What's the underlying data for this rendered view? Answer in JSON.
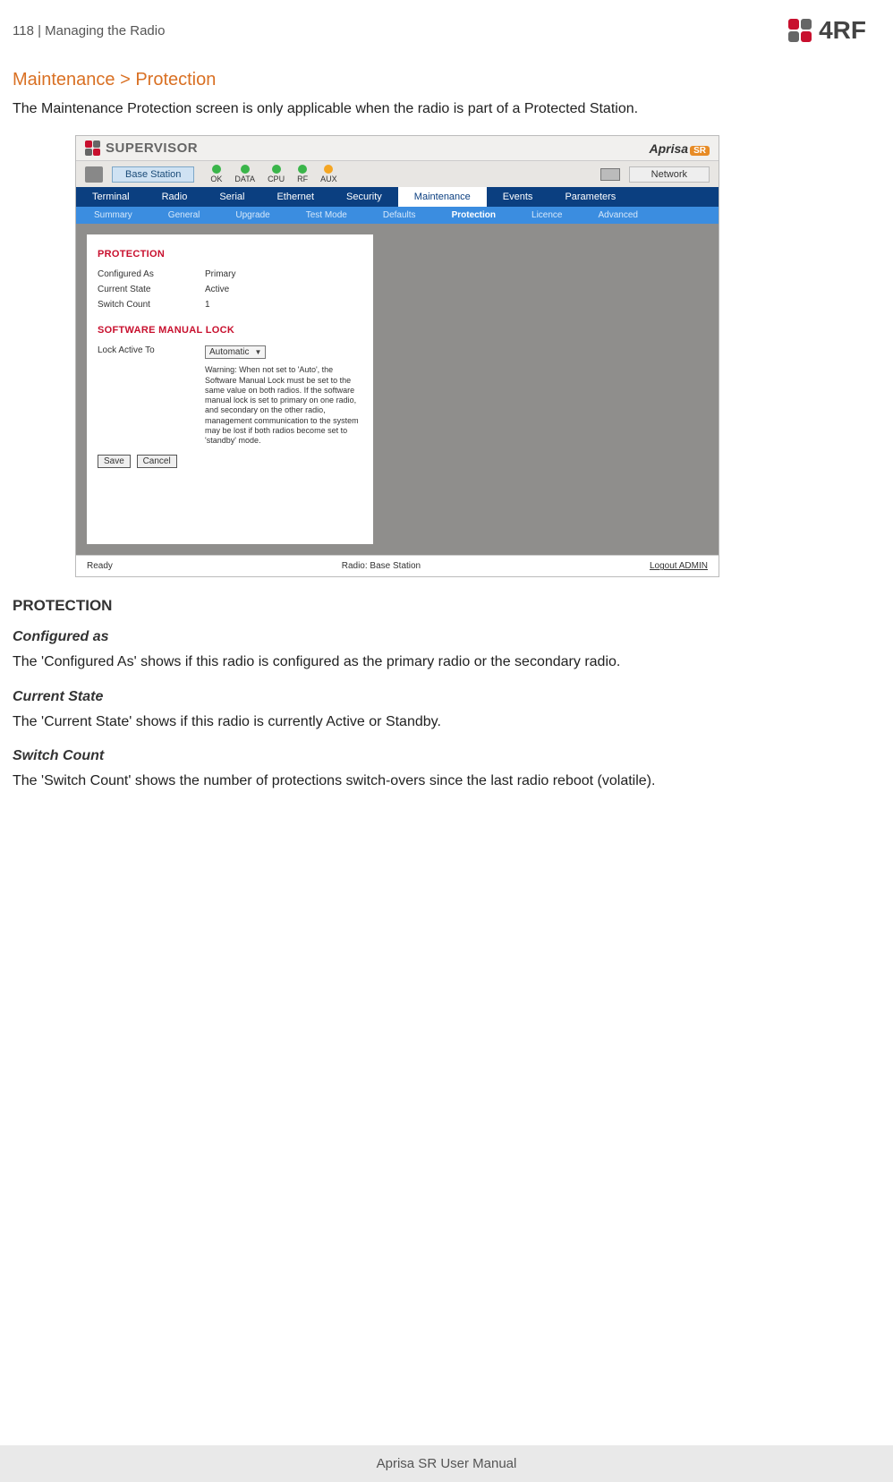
{
  "header": {
    "page_number": "118",
    "section": "Managing the Radio",
    "brand": "4RF"
  },
  "page": {
    "title": "Maintenance > Protection",
    "intro": "The Maintenance Protection screen is only applicable when the radio is part of a Protected Station.",
    "footer": "Aprisa SR User Manual"
  },
  "screenshot": {
    "supervisor_label": "SUPERVISOR",
    "product_logo": {
      "name": "Aprisa",
      "suffix": "SR"
    },
    "station_type": "Base Station",
    "leds": [
      "OK",
      "DATA",
      "CPU",
      "RF",
      "AUX"
    ],
    "network_label": "Network",
    "nav_main": [
      "Terminal",
      "Radio",
      "Serial",
      "Ethernet",
      "Security",
      "Maintenance",
      "Events",
      "Parameters"
    ],
    "nav_main_active": "Maintenance",
    "nav_sub": [
      "Summary",
      "General",
      "Upgrade",
      "Test Mode",
      "Defaults",
      "Protection",
      "Licence",
      "Advanced"
    ],
    "nav_sub_active": "Protection",
    "panel": {
      "protection_header": "PROTECTION",
      "configured_as_label": "Configured As",
      "configured_as_value": "Primary",
      "current_state_label": "Current State",
      "current_state_value": "Active",
      "switch_count_label": "Switch Count",
      "switch_count_value": "1",
      "lock_header": "SOFTWARE MANUAL LOCK",
      "lock_label": "Lock Active To",
      "lock_select_value": "Automatic",
      "warning": "Warning: When not set to 'Auto', the Software Manual Lock must be set to the same value on both radios. If the software manual lock is set to primary on one radio, and secondary on the other radio, management communication to the system may be lost if both radios become set to 'standby' mode.",
      "save_btn": "Save",
      "cancel_btn": "Cancel"
    },
    "footer": {
      "status": "Ready",
      "radio_info": "Radio: Base Station",
      "logout": "Logout ADMIN"
    }
  },
  "doc": {
    "protection_h": "PROTECTION",
    "configured_h": "Configured as",
    "configured_p": "The 'Configured As' shows if this radio is configured as the primary radio or the secondary radio.",
    "current_h": "Current State",
    "current_p": "The 'Current State' shows if this radio is currently Active or Standby.",
    "switch_h": "Switch Count",
    "switch_p": "The 'Switch Count' shows the number of protections switch-overs since the last radio reboot (volatile)."
  }
}
